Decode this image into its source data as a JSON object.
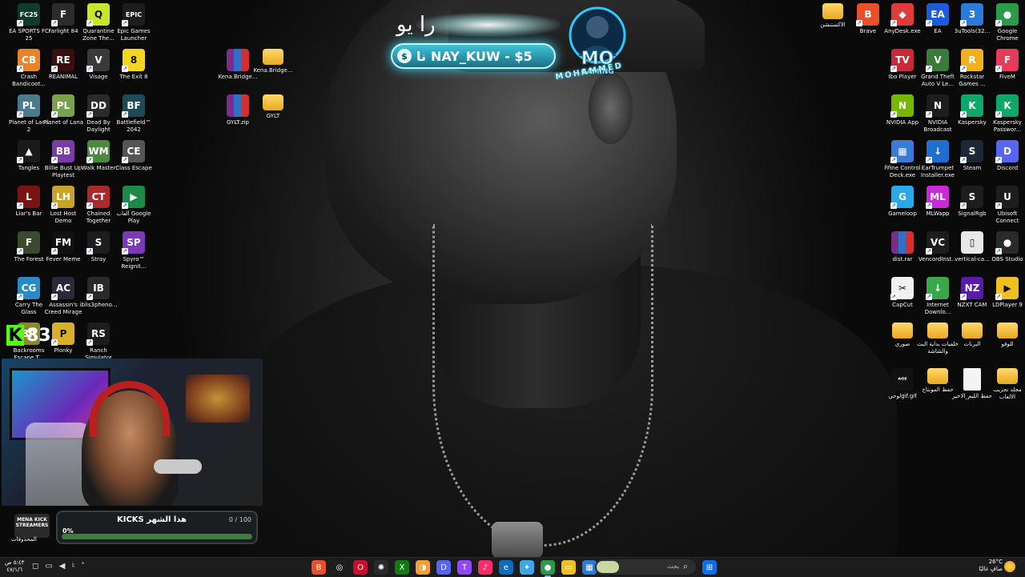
{
  "overlay": {
    "arabic_text": "را  يو",
    "donation": "NAY_KUW - $5",
    "donation_prefix": "نا",
    "coin": "$",
    "logo_main": "MO",
    "logo_sub": "GAMING",
    "logo_name": "MOHAMMED"
  },
  "desktop_icons": [
    {
      "id": "ea-sports-fc25",
      "label": "EA SPORTS FC 25",
      "short": "FC25",
      "color": "#0f3b2c"
    },
    {
      "id": "farlight84",
      "label": "Farlight 84",
      "short": "F",
      "color": "#2b2b2b"
    },
    {
      "id": "quarantine-zone",
      "label": "Quarantine Zone The...",
      "short": "Q",
      "color": "#c8e62a"
    },
    {
      "id": "epic-games",
      "label": "Epic Games Launcher",
      "short": "EPIC",
      "color": "#1d1d1d"
    },
    {
      "id": "crash-bandicoot",
      "label": "Crash Bandicoot...",
      "short": "CB",
      "color": "#e8842a"
    },
    {
      "id": "reanimal",
      "label": "REANIMAL",
      "short": "RE",
      "color": "#3a0e0e"
    },
    {
      "id": "visage",
      "label": "Visage",
      "short": "V",
      "color": "#3a3a3a"
    },
    {
      "id": "exit8",
      "label": "The Exit 8",
      "short": "8",
      "color": "#f3d624"
    },
    {
      "id": "planet-of-lana-2",
      "label": "Planet of Lana 2",
      "short": "PL",
      "color": "#4b7a8a"
    },
    {
      "id": "planet-of-lana",
      "label": "Planet of Lana",
      "short": "PL",
      "color": "#7aa24a"
    },
    {
      "id": "dead-by-daylight",
      "label": "Dead By Daylight",
      "short": "DD",
      "color": "#2a2a2a"
    },
    {
      "id": "battlefield-2042",
      "label": "Battlefield™ 2042",
      "short": "BF",
      "color": "#1e4a55"
    },
    {
      "id": "tangles",
      "label": "Tangles",
      "short": "▲",
      "color": "#1a1a1a"
    },
    {
      "id": "billie-bust-up",
      "label": "Billie Bust Up Playtest",
      "short": "BB",
      "color": "#7b3aa8"
    },
    {
      "id": "walk-master",
      "label": "Walk Master",
      "short": "WM",
      "color": "#4a8a3a"
    },
    {
      "id": "class-escape",
      "label": "Class Escape",
      "short": "CE",
      "color": "#555555"
    },
    {
      "id": "liars-bar",
      "label": "Liar's Bar",
      "short": "L",
      "color": "#7a1414"
    },
    {
      "id": "lost-host",
      "label": "Lost Host Demo",
      "short": "LH",
      "color": "#c9a22a"
    },
    {
      "id": "chained-together",
      "label": "Chained Together",
      "short": "CT",
      "color": "#a82a2a"
    },
    {
      "id": "google-play-games",
      "label": "ألعاب Google Play",
      "short": "▶",
      "color": "#1e8a4a"
    },
    {
      "id": "the-forest",
      "label": "The Forest",
      "short": "F",
      "color": "#3a4a2a"
    },
    {
      "id": "fever-meme",
      "label": "Fever Meme",
      "short": "FM",
      "color": "#111111"
    },
    {
      "id": "stray",
      "label": "Stray",
      "short": "S",
      "color": "#1d1d1d"
    },
    {
      "id": "spyro",
      "label": "Spyro™ Reignit...",
      "short": "SP",
      "color": "#7a3ab8"
    },
    {
      "id": "carry-the-glass",
      "label": "Carry The Glass",
      "short": "CG",
      "color": "#2a8ac8"
    },
    {
      "id": "assassins-creed-mirage",
      "label": "Assassin's Creed Mirage",
      "short": "AC",
      "color": "#2a2a3a"
    },
    {
      "id": "iblis",
      "label": "iblis3pheno...",
      "short": "IB",
      "color": "#2a2a2a"
    },
    {
      "id": "backrooms",
      "label": "Backrooms Escape T...",
      "short": "BR",
      "color": "#8a8a2a"
    },
    {
      "id": "plonky",
      "label": "Plonky",
      "short": "P",
      "color": "#d8b02a"
    },
    {
      "id": "ranch-simulator",
      "label": "Ranch Simulator",
      "short": "RS",
      "color": "#1d1d1d"
    },
    {
      "id": "kena-rar",
      "label": "Kena.Bridge...",
      "short": "",
      "color": "",
      "type": "rar"
    },
    {
      "id": "kena-folder",
      "label": "Kena.Bridge...",
      "short": "",
      "color": "",
      "type": "folder"
    },
    {
      "id": "gylt-zip",
      "label": "GYLT.zip",
      "short": "",
      "color": "",
      "type": "rar"
    },
    {
      "id": "gylt-folder",
      "label": "GYLT",
      "short": "",
      "color": "",
      "type": "folder"
    },
    {
      "id": "extensions-folder",
      "label": "الاكستنشن",
      "short": "",
      "color": "",
      "type": "folder"
    },
    {
      "id": "brave",
      "label": "Brave",
      "short": "B",
      "color": "#e8502a"
    },
    {
      "id": "anydesk",
      "label": "AnyDesk.exe",
      "short": "◆",
      "color": "#e03a3a"
    },
    {
      "id": "ea",
      "label": "EA",
      "short": "EA",
      "color": "#1d5ad8"
    },
    {
      "id": "3utools",
      "label": "3uTools(32...",
      "short": "3",
      "color": "#2a7ad8"
    },
    {
      "id": "google-chrome",
      "label": "Google Chrome",
      "short": "●",
      "color": "#2a9a4a"
    },
    {
      "id": "ibo-player",
      "label": "Ibo Player",
      "short": "TV",
      "color": "#c82a3a"
    },
    {
      "id": "gta-v",
      "label": "Grand Theft Auto V Le...",
      "short": "V",
      "color": "#3a7a3a"
    },
    {
      "id": "rockstar",
      "label": "Rockstar Games ...",
      "short": "R",
      "color": "#f0b020"
    },
    {
      "id": "fivem",
      "label": "FiveM",
      "short": "F",
      "color": "#e83a5a"
    },
    {
      "id": "nvidia-app",
      "label": "NVIDIA App",
      "short": "N",
      "color": "#76b900"
    },
    {
      "id": "nvidia-broadcast",
      "label": "NVIDIA Broadcast",
      "short": "N",
      "color": "#1d1d1d"
    },
    {
      "id": "kaspersky",
      "label": "Kaspersky",
      "short": "K",
      "color": "#10a86a"
    },
    {
      "id": "kaspersky-password",
      "label": "Kaspersky Passwor...",
      "short": "K",
      "color": "#10a86a"
    },
    {
      "id": "fifine",
      "label": "fifine Control Deck.exe",
      "short": "▦",
      "color": "#3a7ad8"
    },
    {
      "id": "eartrumpet",
      "label": "EarTrumpet Installer.exe",
      "short": "↓",
      "color": "#1e6fd0"
    },
    {
      "id": "steam",
      "label": "Steam",
      "short": "S",
      "color": "#1b2838"
    },
    {
      "id": "discord",
      "label": "Discord",
      "short": "D",
      "color": "#5865f2"
    },
    {
      "id": "gameloop",
      "label": "Gameloop",
      "short": "G",
      "color": "#2aa8e8"
    },
    {
      "id": "mlwapp",
      "label": "MLWapp",
      "short": "ML",
      "color": "#c82ad8"
    },
    {
      "id": "signalrgb",
      "label": "SignalRgb",
      "short": "S",
      "color": "#1d1d1d"
    },
    {
      "id": "ubisoft",
      "label": "Ubisoft Connect",
      "short": "U",
      "color": "#1d1d1d"
    },
    {
      "id": "dist-rar",
      "label": "dist.rar",
      "short": "",
      "color": "",
      "type": "rar"
    },
    {
      "id": "vencord",
      "label": "VencordInst...",
      "short": "VC",
      "color": "#1d1d1d"
    },
    {
      "id": "vertical-ca",
      "label": "vertical-ca...",
      "short": "▯",
      "color": "#e8e8e8"
    },
    {
      "id": "obs",
      "label": "OBS Studio",
      "short": "●",
      "color": "#2a2a2a"
    },
    {
      "id": "capcut",
      "label": "CapCut",
      "short": "✂",
      "color": "#f0f0f0"
    },
    {
      "id": "idm",
      "label": "Internet Downlo...",
      "short": "↓",
      "color": "#3aa84a"
    },
    {
      "id": "nzxt-cam",
      "label": "NZXT CAM",
      "short": "NZ",
      "color": "#5a1aa8"
    },
    {
      "id": "ldplayer",
      "label": "LDPlayer 9",
      "short": "▶",
      "color": "#f0c020"
    },
    {
      "id": "pictures-folder",
      "label": "صوري",
      "short": "",
      "color": "",
      "type": "folder"
    },
    {
      "id": "stream-folder",
      "label": "خلفيات بداية البث والشاشة",
      "short": "",
      "color": "",
      "type": "folder"
    },
    {
      "id": "programs-folder",
      "label": "البرنات",
      "short": "",
      "color": "",
      "type": "folder"
    },
    {
      "id": "logo-folder",
      "label": "للوقو",
      "short": "",
      "color": "",
      "type": "folder"
    },
    {
      "id": "gif-file",
      "label": "لوجيgif.gif",
      "short": "ᴬᴳᴱ",
      "color": "#111111"
    },
    {
      "id": "montage-folder",
      "label": "حفظ المونتاج",
      "short": "",
      "color": "",
      "type": "folder"
    },
    {
      "id": "doc-file",
      "label": "حفظ الليم_الاخير",
      "short": "",
      "color": "#f4f4f4",
      "type": "doc"
    },
    {
      "id": "games-folder",
      "label": "مجلد تجريب الالعاب",
      "short": "",
      "color": "",
      "type": "folder"
    }
  ],
  "widget": {
    "kicks_title": "KICKS هذا الشهر",
    "count": "0 / 100",
    "percent": "0%",
    "progress": 0,
    "mena_logo": "MENA KICK STREAMERS",
    "mena_label": "المحذوفات",
    "k_badge": "K",
    "k_number": "83"
  },
  "taskbar": {
    "time": "٥:٤٣ ص",
    "date": "٤٧/١/٦",
    "search_placeholder": "بحث",
    "weather_temp": "26°C",
    "weather_desc": "صافٍ غالبًا",
    "apps": [
      "brave",
      "chatgpt",
      "opera",
      "openai",
      "xbox",
      "photos",
      "discord",
      "twitch",
      "itunes",
      "edge",
      "copilot",
      "chrome",
      "explorer",
      "store",
      "media",
      "widget"
    ]
  }
}
